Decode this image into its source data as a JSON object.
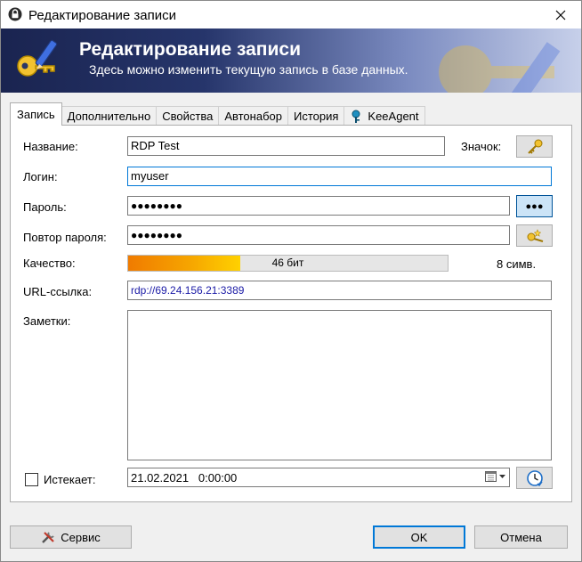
{
  "window": {
    "title": "Редактирование записи"
  },
  "banner": {
    "title": "Редактирование записи",
    "subtitle": "Здесь можно изменить текущую запись в базе данных."
  },
  "tabs": [
    {
      "label": "Запись",
      "active": true
    },
    {
      "label": "Дополнительно"
    },
    {
      "label": "Свойства"
    },
    {
      "label": "Автонабор"
    },
    {
      "label": "История"
    },
    {
      "label": "KeeAgent",
      "icon": "keeagent-icon"
    }
  ],
  "form": {
    "title_label": "Название:",
    "title_value": "RDP Test",
    "icon_label": "Значок:",
    "username_label": "Логин:",
    "username_value": "myuser",
    "password_label": "Пароль:",
    "password_value": "●●●●●●●●",
    "repeat_label": "Повтор пароля:",
    "repeat_value": "●●●●●●●●",
    "show_password_button": "●●●",
    "quality_label": "Качество:",
    "quality_text": "46 бит",
    "quality_fraction": 0.35,
    "chars_text": "8 симв.",
    "url_label": "URL-ссылка:",
    "url_value": "rdp://69.24.156.21:3389",
    "notes_label": "Заметки:",
    "notes_value": "",
    "expires_label": "Истекает:",
    "expires_checked": false,
    "expires_value": "21.02.2021   0:00:00"
  },
  "buttons": {
    "tools": "Сервис",
    "ok": "OK",
    "cancel": "Отмена"
  },
  "colors": {
    "accent": "#0078d7",
    "url_text": "#1a1aa6",
    "quality_start": "#f07b00",
    "quality_end": "#ffd100"
  }
}
